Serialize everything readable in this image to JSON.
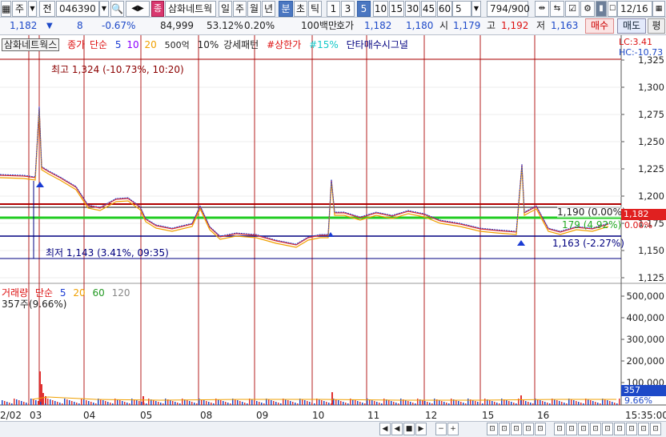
{
  "toolbar": {
    "period_type": "주",
    "market": "전",
    "code": "046390",
    "company_badge": "종",
    "company_name": "삼화네트웍",
    "period_buttons": [
      "일",
      "주",
      "월",
      "년",
      "분",
      "초",
      "틱"
    ],
    "minute_buttons": [
      "1",
      "3",
      "5",
      "10",
      "15",
      "30",
      "45",
      "60"
    ],
    "interval_value": "5",
    "count_value": "794",
    "count_total": "/900",
    "date_value": "12/16"
  },
  "quote": {
    "price": "1,182",
    "change": "8",
    "change_pct": "-0.67%",
    "volume": "84,999",
    "ratio": "53.12%",
    "turnover": "0.20%",
    "unit_label": "100백만",
    "ask_label": "호가",
    "ask": "1,182",
    "bid": "1,180",
    "open_label": "시",
    "open": "1,179",
    "high_label": "고",
    "high": "1,192",
    "low_label": "저",
    "low": "1,163",
    "buy_button": "매수",
    "sell_button": "매도",
    "eval_button": "평"
  },
  "legend": {
    "name": "삼화네트웍스",
    "price_label": "종가",
    "ma_type": "단순",
    "ma": [
      "5",
      "10",
      "20"
    ],
    "indicator_1": "500억",
    "indicator_2": "10%",
    "indicator_3": "강세패턴",
    "indicator_4": "#상한가",
    "indicator_5": "#15%",
    "indicator_6": "단타매수시그널",
    "lc": "LC:3.41",
    "hc": "HC:-10.73"
  },
  "annotations": {
    "high": "최고 1,324 (-10.73%, 10:20)",
    "low": "최저 1,143 (3.41%, 09:35)",
    "line_1190": "1,190 (0.00%)",
    "line_179": "179 (4.92%)",
    "line_1163": "1,163 (-2.27%)",
    "current_price_box": "1,182",
    "pct_box": "0.00%"
  },
  "price_axis": [
    "1,325",
    "1,300",
    "1,275",
    "1,250",
    "1,225",
    "1,200",
    "1,175",
    "1,150",
    "1,125"
  ],
  "volume_legend": {
    "label": "거래량",
    "ma_type": "단순",
    "ma": [
      "5",
      "20",
      "60",
      "120"
    ],
    "last": "357주(9.66%)"
  },
  "volume_axis": [
    "500,000",
    "400,000",
    "300,000",
    "200,000",
    "100,000"
  ],
  "volume_box": "357",
  "volume_pct": "9.66%",
  "x_labels": [
    "2/02",
    "03",
    "04",
    "05",
    "08",
    "09",
    "10",
    "11",
    "12",
    "15",
    "16"
  ],
  "time_label": "15:35:00",
  "colors": {
    "up": "#d11",
    "down": "#1d49c8",
    "ma5": "#1a3bd3",
    "ma10": "#8b00ff",
    "ma20": "#f0a000",
    "green_line": "#22cc22",
    "red_line": "#b00000",
    "navy_line": "#000080",
    "day_divider": "#b41f1f"
  }
}
